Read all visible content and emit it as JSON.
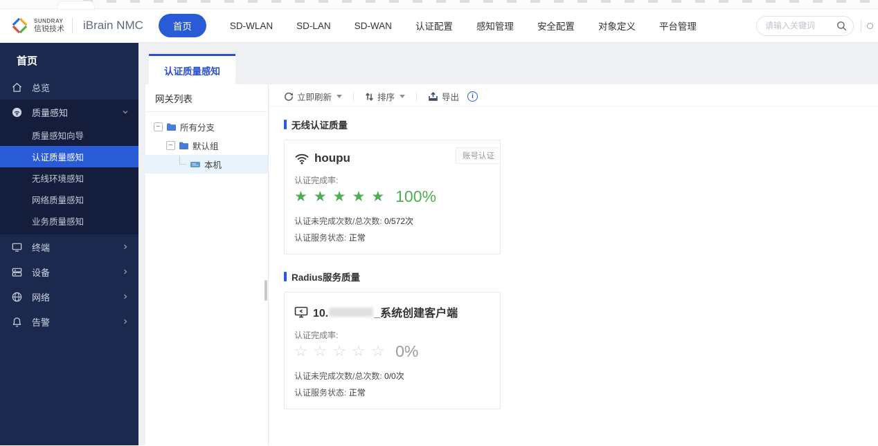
{
  "header": {
    "brand": {
      "company_en": "SUNDRAY",
      "company_cn": "信锐技术",
      "product": "iBrain NMC"
    },
    "nav": [
      {
        "label": "首页",
        "active": true
      },
      {
        "label": "SD-WLAN"
      },
      {
        "label": "SD-LAN"
      },
      {
        "label": "SD-WAN"
      },
      {
        "label": "认证配置"
      },
      {
        "label": "感知管理"
      },
      {
        "label": "安全配置"
      },
      {
        "label": "对象定义"
      },
      {
        "label": "平台管理"
      }
    ],
    "search_placeholder": "请输入关键词"
  },
  "sidebar": {
    "title": "首页",
    "overview": "总览",
    "quality_group": {
      "label": "质量感知",
      "children": [
        "质量感知向导",
        "认证质量感知",
        "无线环境感知",
        "网络质量感知",
        "业务质量感知"
      ],
      "active_child": "认证质量感知"
    },
    "terminal": "终端",
    "device": "设备",
    "network": "网络",
    "alarm": "告警"
  },
  "main": {
    "tab": "认证质量感知",
    "tree": {
      "title": "网关列表",
      "root": "所有分支",
      "group": "默认组",
      "leaf": "本机"
    },
    "toolbar": {
      "refresh": "立即刷新",
      "sort": "排序",
      "export": "导出"
    },
    "wireless_section": {
      "title": "无线认证质量",
      "card": {
        "name": "houpu",
        "badge": "账号认证",
        "rate_label": "认证完成率:",
        "stars_filled": 5,
        "stars_total": 5,
        "percent": "100%",
        "count_label": "认证未完成次数/总次数:",
        "count_value": "0/572次",
        "status_label": "认证服务状态:",
        "status_value": "正常"
      }
    },
    "radius_section": {
      "title": "Radius服务质量",
      "card": {
        "name_prefix": "10.",
        "name_redacted": true,
        "name_suffix": "_系统创建客户端",
        "rate_label": "认证完成率:",
        "stars_filled": 0,
        "stars_total": 5,
        "percent": "0%",
        "count_label": "认证未完成次数/总次数:",
        "count_value": "0/0次",
        "status_label": "认证服务状态:",
        "status_value": "正常"
      }
    }
  },
  "glyphs": {
    "star_filled": "★",
    "star_empty": "☆",
    "minus": "−",
    "info": "i"
  },
  "colors": {
    "primary": "#2a5bd7",
    "green": "#4caf50",
    "sidebar_bg": "#1c294e",
    "sidebar_sub_bg": "#141e3c",
    "selected_row": "#e8f3fc"
  }
}
